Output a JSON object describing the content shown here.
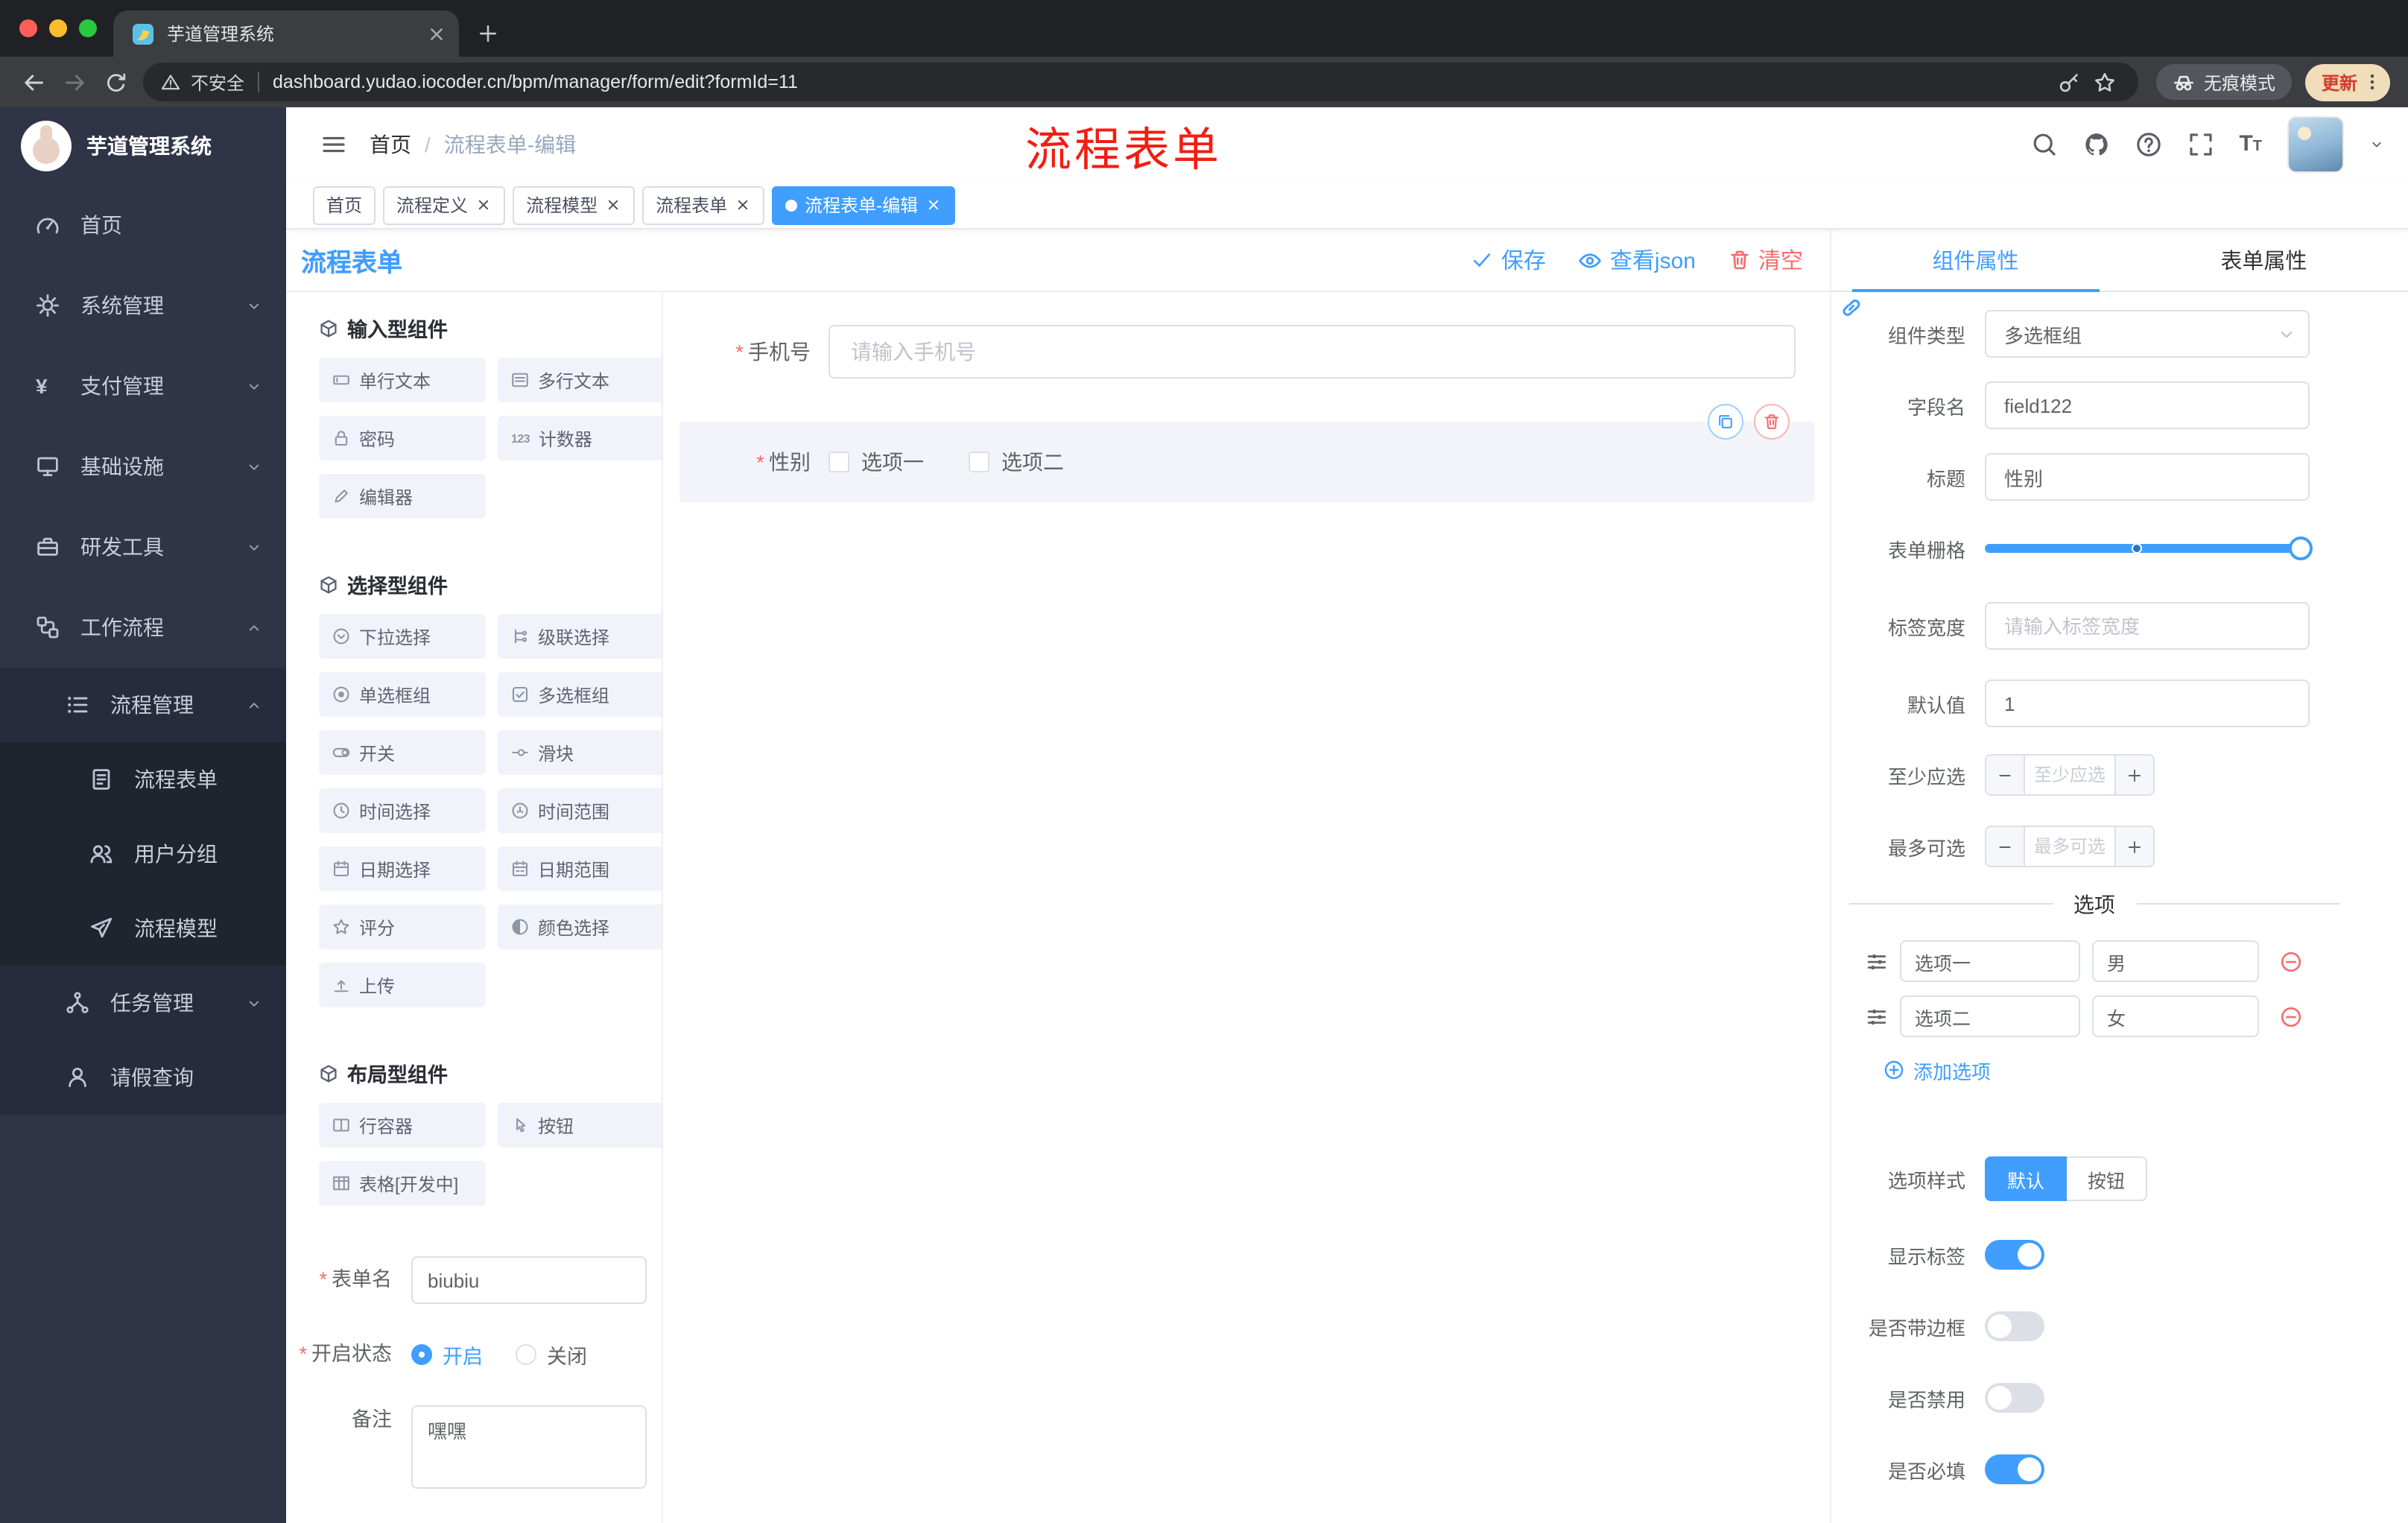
{
  "browser": {
    "tab_title": "芋道管理系统",
    "security_label": "不安全",
    "url": "dashboard.yudao.iocoder.cn/bpm/manager/form/edit?formId=11",
    "incognito_label": "无痕模式",
    "update_label": "更新"
  },
  "header": {
    "logo_title": "芋道管理系统",
    "breadcrumb_home": "首页",
    "breadcrumb_current": "流程表单-编辑",
    "annotation": "流程表单"
  },
  "ui": {
    "required_mark": "*",
    "breadcrumb_separator": "/"
  },
  "tags": [
    {
      "id": "home",
      "label": "首页",
      "closable": false,
      "active": false
    },
    {
      "id": "process-definition",
      "label": "流程定义",
      "closable": true,
      "active": false
    },
    {
      "id": "process-model",
      "label": "流程模型",
      "closable": true,
      "active": false
    },
    {
      "id": "process-form",
      "label": "流程表单",
      "closable": true,
      "active": false
    },
    {
      "id": "process-form-edit",
      "label": "流程表单-编辑",
      "closable": true,
      "active": true
    }
  ],
  "sidebar": [
    {
      "id": "home",
      "label": "首页",
      "icon": "gauge",
      "level": 0
    },
    {
      "id": "system-management",
      "label": "系统管理",
      "icon": "gear",
      "level": 0,
      "arrow": "down"
    },
    {
      "id": "payment-management",
      "label": "支付管理",
      "icon": "yen",
      "level": 0,
      "arrow": "down"
    },
    {
      "id": "infrastructure",
      "label": "基础设施",
      "icon": "monitor",
      "level": 0,
      "arrow": "down"
    },
    {
      "id": "dev-tools",
      "label": "研发工具",
      "icon": "toolbox",
      "level": 0,
      "arrow": "down"
    },
    {
      "id": "workflow",
      "label": "工作流程",
      "icon": "flow",
      "level": 0,
      "arrow": "up"
    },
    {
      "id": "process-management",
      "label": "流程管理",
      "icon": "list",
      "level": 1,
      "arrow": "up"
    },
    {
      "id": "process-form",
      "label": "流程表单",
      "icon": "doc",
      "level": 2
    },
    {
      "id": "user-group",
      "label": "用户分组",
      "icon": "users",
      "level": 2
    },
    {
      "id": "process-model",
      "label": "流程模型",
      "icon": "send",
      "level": 2
    },
    {
      "id": "task-management",
      "label": "任务管理",
      "icon": "tree",
      "level": 1,
      "arrow": "down"
    },
    {
      "id": "leave-query",
      "label": "请假查询",
      "icon": "person",
      "level": 1
    }
  ],
  "designer": {
    "title": "流程表单",
    "save_label": "保存",
    "view_json_label": "查看json",
    "clear_label": "清空"
  },
  "palette": {
    "sections": [
      {
        "title": "输入型组件",
        "items": [
          {
            "id": "single-line-text",
            "label": "单行文本",
            "icon": "input"
          },
          {
            "id": "multi-line-text",
            "label": "多行文本",
            "icon": "textarea"
          },
          {
            "id": "password",
            "label": "密码",
            "icon": "lock"
          },
          {
            "id": "counter",
            "label": "计数器",
            "icon": "counter"
          },
          {
            "id": "editor",
            "label": "编辑器",
            "icon": "editor"
          }
        ]
      },
      {
        "title": "选择型组件",
        "items": [
          {
            "id": "select",
            "label": "下拉选择",
            "icon": "select"
          },
          {
            "id": "cascader",
            "label": "级联选择",
            "icon": "cascader"
          },
          {
            "id": "radio-group",
            "label": "单选框组",
            "icon": "radio"
          },
          {
            "id": "checkbox-group",
            "label": "多选框组",
            "icon": "checkbox"
          },
          {
            "id": "switch",
            "label": "开关",
            "icon": "switch"
          },
          {
            "id": "slider",
            "label": "滑块",
            "icon": "slideric"
          },
          {
            "id": "time-picker",
            "label": "时间选择",
            "icon": "time"
          },
          {
            "id": "time-range",
            "label": "时间范围",
            "icon": "time-range"
          },
          {
            "id": "date-picker",
            "label": "日期选择",
            "icon": "date"
          },
          {
            "id": "date-range",
            "label": "日期范围",
            "icon": "date-range"
          },
          {
            "id": "rate",
            "label": "评分",
            "icon": "star"
          },
          {
            "id": "color-picker",
            "label": "颜色选择",
            "icon": "color"
          },
          {
            "id": "upload",
            "label": "上传",
            "icon": "upload"
          }
        ]
      },
      {
        "title": "布局型组件",
        "items": [
          {
            "id": "row-container",
            "label": "行容器",
            "icon": "row"
          },
          {
            "id": "button",
            "label": "按钮",
            "icon": "hand"
          },
          {
            "id": "table-dev",
            "label": "表格[开发中]",
            "icon": "table"
          }
        ]
      }
    ]
  },
  "form_meta": {
    "name_label": "表单名",
    "name_value": "biubiu",
    "status_label": "开启状态",
    "status_on": "开启",
    "status_off": "关闭",
    "remark_label": "备注",
    "remark_value": "嘿嘿"
  },
  "canvas": {
    "phone_label": "手机号",
    "phone_placeholder": "请输入手机号",
    "gender_label": "性别",
    "gender_options": [
      "选项一",
      "选项二"
    ]
  },
  "properties": {
    "tab_component": "组件属性",
    "tab_form": "表单属性",
    "component_type_label": "组件类型",
    "component_type_value": "多选框组",
    "field_name_label": "字段名",
    "field_name_value": "field122",
    "title_label": "标题",
    "title_value": "性别",
    "grid_label": "表单栅格",
    "label_width_label": "标签宽度",
    "label_width_placeholder": "请输入标签宽度",
    "default_label": "默认值",
    "default_value": "1",
    "min_label": "至少应选",
    "min_placeholder": "至少应选",
    "max_label": "最多可选",
    "max_placeholder": "最多可选",
    "options_title": "选项",
    "options": [
      {
        "label": "选项一",
        "value": "男"
      },
      {
        "label": "选项二",
        "value": "女"
      }
    ],
    "add_option_label": "添加选项",
    "style_label": "选项样式",
    "style_default": "默认",
    "style_button": "按钮",
    "switches": [
      {
        "id": "show-label",
        "label": "显示标签",
        "on": true
      },
      {
        "id": "bordered",
        "label": "是否带边框",
        "on": false
      },
      {
        "id": "disabled",
        "label": "是否禁用",
        "on": false
      },
      {
        "id": "required",
        "label": "是否必填",
        "on": true
      }
    ]
  },
  "colors": {
    "accent": "#409eff",
    "danger": "#f56c6c",
    "annotation": "#f11e12",
    "sidebar_bg": "#2f3447",
    "tag_active": "#409eff"
  }
}
